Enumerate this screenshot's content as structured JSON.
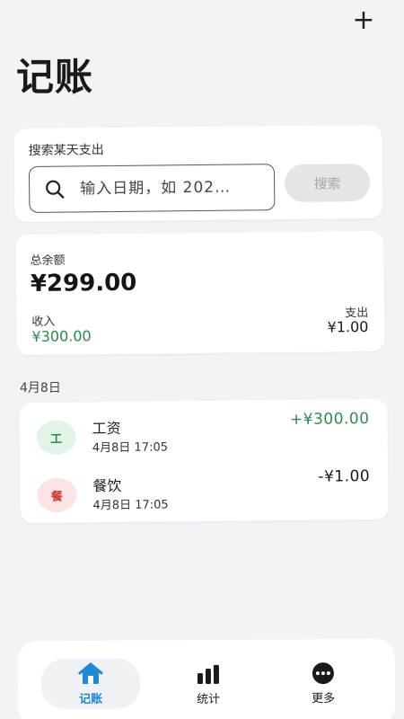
{
  "header": {
    "add_symbol": "+",
    "title": "记账"
  },
  "search": {
    "label": "搜索某天支出",
    "placeholder": "输入日期，如 202…",
    "button_label": "搜索"
  },
  "balance": {
    "label": "总余额",
    "amount": "¥299.00",
    "income_label": "收入",
    "income_value": "¥300.00",
    "expense_label": "支出",
    "expense_value": "¥1.00"
  },
  "transactions": {
    "date_header": "4月8日",
    "items": [
      {
        "icon_char": "工",
        "name": "工资",
        "time": "4月8日 17:05",
        "amount": "+¥300.00"
      },
      {
        "icon_char": "餐",
        "name": "餐饮",
        "time": "4月8日 17:05",
        "amount": "-¥1.00"
      }
    ]
  },
  "tabs": [
    {
      "label": "记账",
      "icon": "home-icon"
    },
    {
      "label": "统计",
      "icon": "bar-chart-icon"
    },
    {
      "label": "更多",
      "icon": "more-icon"
    }
  ],
  "colors": {
    "accent": "#1e88d6",
    "income": "#2d8a4e",
    "food_icon": "#d33a3a",
    "background": "#f3f3f6"
  }
}
